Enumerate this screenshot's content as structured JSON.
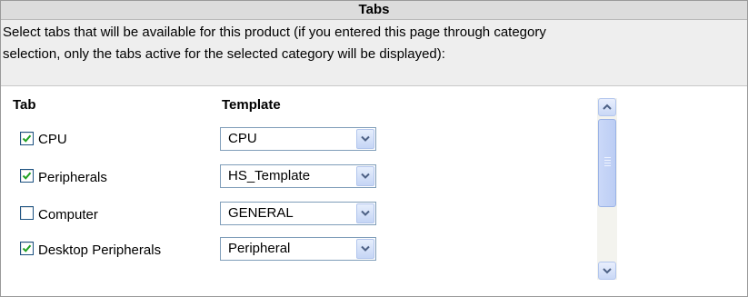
{
  "panel": {
    "title": "Tabs",
    "description_line1": "Select tabs that will be available for this product (if you entered this page through category",
    "description_line2": "selection, only the tabs active for the selected category will be displayed):"
  },
  "columns": {
    "tab": "Tab",
    "template": "Template"
  },
  "rows": [
    {
      "label": "CPU",
      "checked": true,
      "template": "CPU"
    },
    {
      "label": "Peripherals",
      "checked": true,
      "template": "HS_Template"
    },
    {
      "label": "Computer",
      "checked": false,
      "template": "GENERAL"
    },
    {
      "label": "Desktop Peripherals",
      "checked": true,
      "template": "Peripheral"
    }
  ],
  "icons": {
    "checkmark": "checkmark-icon",
    "dropdown": "chevron-down-icon",
    "scroll_up": "chevron-up-icon",
    "scroll_down": "chevron-down-icon"
  },
  "colors": {
    "header_bg": "#dcdcdc",
    "description_bg": "#eeeeee",
    "check": "#21a121",
    "control_border": "#7f9db9"
  }
}
